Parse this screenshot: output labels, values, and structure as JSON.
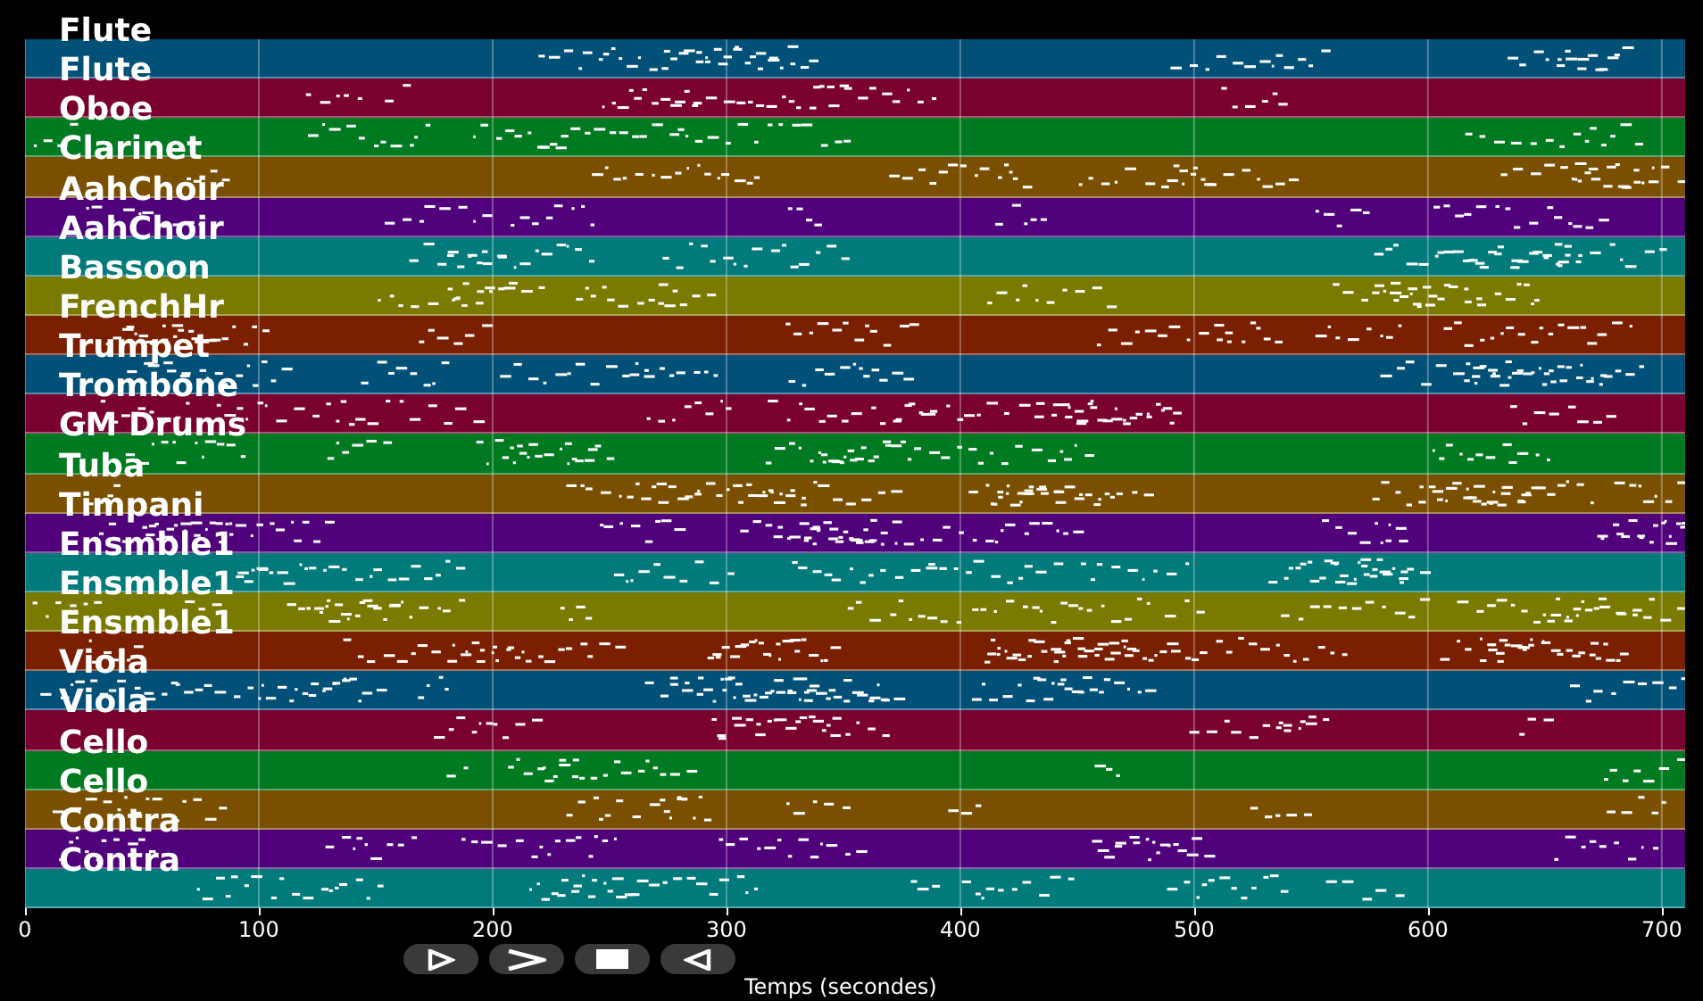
{
  "tracks": [
    {
      "name": "Flute",
      "color": "#005078"
    },
    {
      "name": "Flute",
      "color": "#7a0030"
    },
    {
      "name": "Oboe",
      "color": "#007a20"
    },
    {
      "name": "Clarinet",
      "color": "#7a5000"
    },
    {
      "name": "AahChoir",
      "color": "#50007a"
    },
    {
      "name": "AahChoir",
      "color": "#007a7a"
    },
    {
      "name": "Bassoon",
      "color": "#7a7a00"
    },
    {
      "name": "FrenchHr",
      "color": "#7a2000"
    },
    {
      "name": "Trumpet",
      "color": "#005078"
    },
    {
      "name": "Trombone",
      "color": "#7a0030"
    },
    {
      "name": "GM Drums",
      "color": "#007a20"
    },
    {
      "name": "Tuba",
      "color": "#7a5000"
    },
    {
      "name": "Timpani",
      "color": "#50007a"
    },
    {
      "name": "Ensmble1",
      "color": "#007a7a"
    },
    {
      "name": "Ensmble1",
      "color": "#7a7a00"
    },
    {
      "name": "Ensmble1",
      "color": "#7a2000"
    },
    {
      "name": "Viola",
      "color": "#005078"
    },
    {
      "name": "Viola",
      "color": "#7a0030"
    },
    {
      "name": "Cello",
      "color": "#007a20"
    },
    {
      "name": "Cello",
      "color": "#7a5000"
    },
    {
      "name": "Contra",
      "color": "#50007a"
    },
    {
      "name": "Contra",
      "color": "#007a7a"
    }
  ],
  "x_axis": {
    "ticks": [
      "0",
      "100",
      "200",
      "300",
      "400",
      "500",
      "600",
      "700"
    ],
    "label": "Temps (secondes)"
  },
  "controls": [
    {
      "kind": "play"
    },
    {
      "kind": "forward"
    },
    {
      "kind": "stop"
    },
    {
      "kind": "rewind"
    }
  ]
}
